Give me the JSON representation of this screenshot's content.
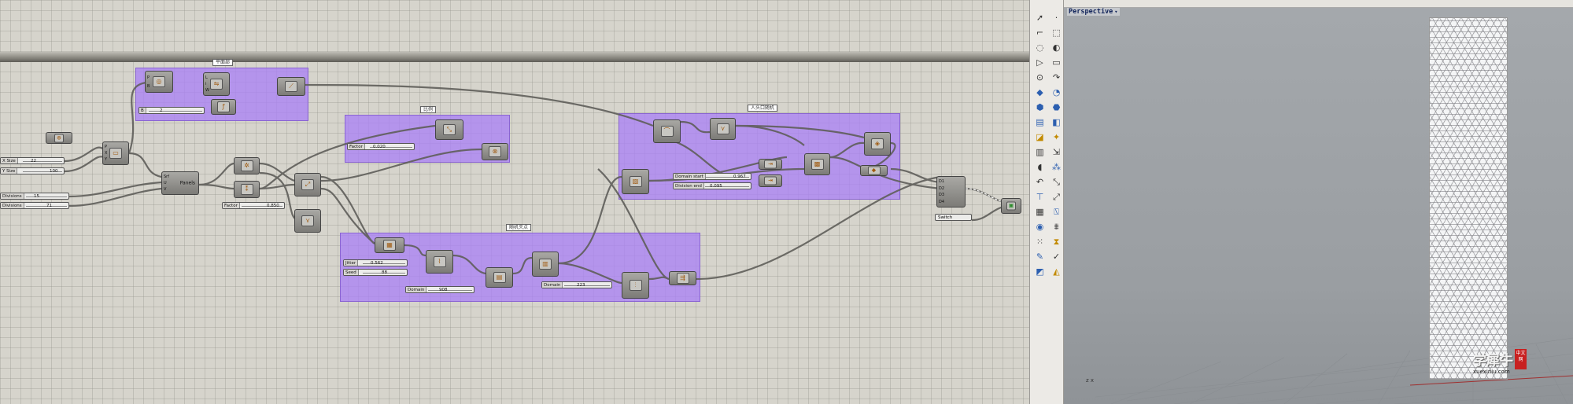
{
  "canvas": {
    "groups": [
      {
        "id": "g1",
        "label": "平面部"
      },
      {
        "id": "g2",
        "label": "比例"
      },
      {
        "id": "g3",
        "label": "随机灭点"
      },
      {
        "id": "g4",
        "label": "人头口随机"
      }
    ],
    "sliders": {
      "xsize": {
        "label": "X Size",
        "value": "22"
      },
      "ysize": {
        "label": "Y Size",
        "value": "100"
      },
      "divisions1": {
        "label": "Divisions",
        "value": "15"
      },
      "divisions2": {
        "label": "Divisions",
        "value": "71"
      },
      "b": {
        "label": "B",
        "value": "2"
      },
      "factor1": {
        "label": "Factor",
        "value": "0.020"
      },
      "factor2": {
        "label": "Factor",
        "value": "0.850"
      },
      "jitter": {
        "label": "Jitter",
        "value": "0.562"
      },
      "seed": {
        "label": "Seed",
        "value": "88"
      },
      "domain1": {
        "label": "Domain",
        "value": "908"
      },
      "domain2": {
        "label": "Domain",
        "value": "223"
      },
      "domain_start": {
        "label": "Domain start",
        "value": "0.967"
      },
      "division_end": {
        "label": "Division end",
        "value": "0.095"
      }
    },
    "components": {
      "panels": "Panels",
      "switch": "Switch"
    }
  },
  "viewport": {
    "title": "Perspective",
    "caret": "▾",
    "axis": "z  x",
    "watermark_cn": "学犀牛",
    "watermark_seal": "中文网",
    "watermark_url": "xuexiniu.com"
  },
  "toolbar": {
    "icons": [
      "select-arrow-icon",
      "point-icon",
      "polyline-icon",
      "rectangle-icon",
      "circle-icon",
      "arc-icon",
      "triangle-icon",
      "trim-icon",
      "polygon-icon",
      "curve-icon",
      "box-icon",
      "sphere-icon",
      "extrude-icon",
      "surface-icon",
      "loft-icon",
      "solid-icon",
      "boolean-icon",
      "fillet-icon",
      "mesh-icon",
      "transform-icon",
      "bend-icon",
      "array-icon",
      "text-icon",
      "dimension-icon",
      "layer-icon",
      "render-icon",
      "grid-icon",
      "lock-icon",
      "check-icon",
      "paint-icon"
    ]
  }
}
